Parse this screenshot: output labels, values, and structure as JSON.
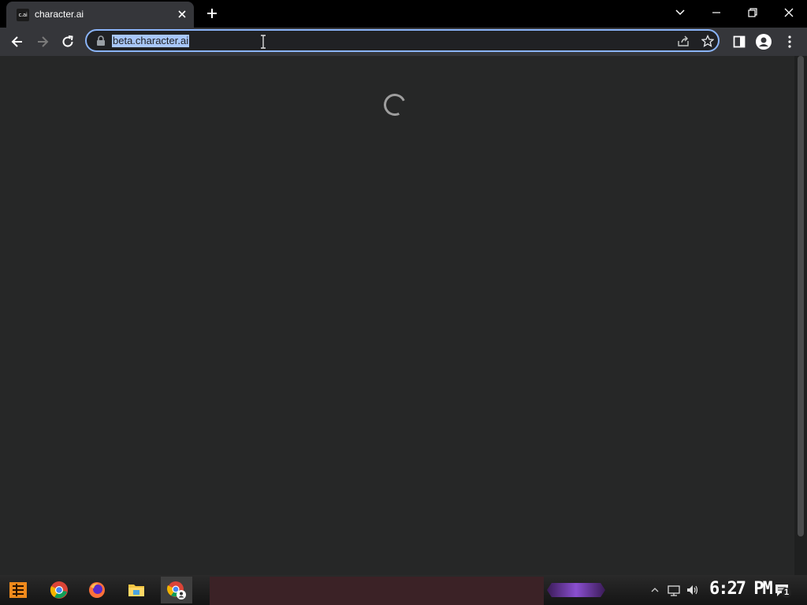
{
  "browser": {
    "tab": {
      "favicon_text": "c.ai",
      "title": "character.ai"
    },
    "address": {
      "url": "beta.character.ai"
    }
  },
  "taskbar": {
    "clock": "6:27 PM",
    "notification_count": "1"
  },
  "colors": {
    "selection": "#a8c7fa",
    "focus_ring": "#8ab4f8",
    "page_bg": "#262727"
  }
}
